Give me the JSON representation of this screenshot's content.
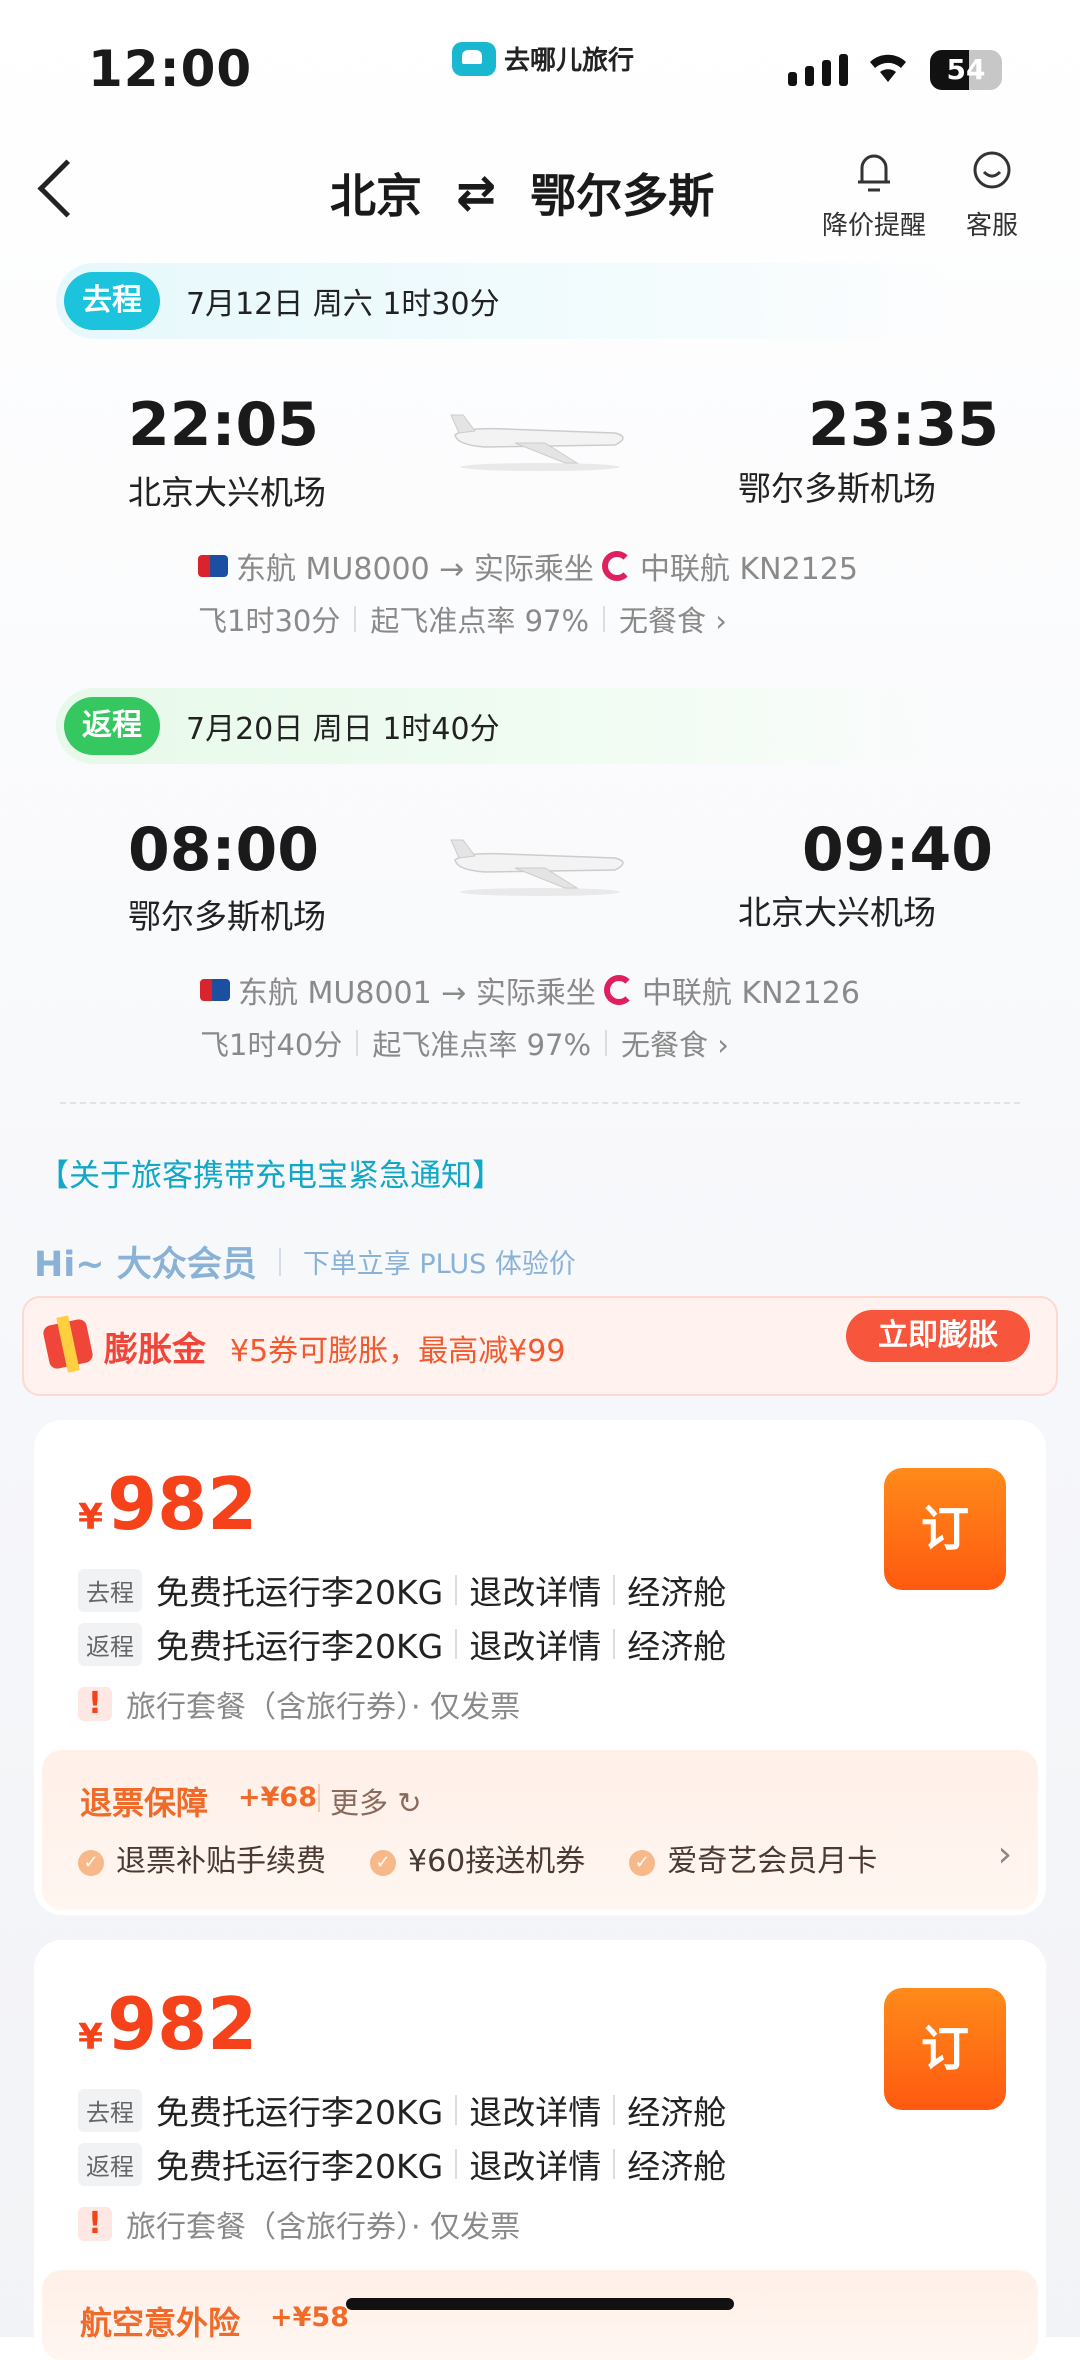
{
  "status": {
    "time": "12:00",
    "battery": "54",
    "brand": "去哪儿旅行"
  },
  "header": {
    "from": "北京",
    "to": "鄂尔多斯",
    "swap_icon": "⇄",
    "back_icon": "chevron-left",
    "alert_label": "降价提醒",
    "service_label": "客服"
  },
  "outbound": {
    "tag": "去程",
    "date_info": "7月12日 周六  1时30分",
    "dep_time": "22:05",
    "dep_airport": "北京大兴机场",
    "arr_time": "23:35",
    "arr_airport": "鄂尔多斯机场",
    "carrier_text": "东航 MU8000 → 实际乘坐",
    "operating_text": "中联航 KN2125",
    "duration": "飞1时30分",
    "ontime": "起飞准点率 97%",
    "meal": "无餐食 ›"
  },
  "return": {
    "tag": "返程",
    "date_info": "7月20日 周日  1时40分",
    "dep_time": "08:00",
    "dep_airport": "鄂尔多斯机场",
    "arr_time": "09:40",
    "arr_airport": "北京大兴机场",
    "carrier_text": "东航 MU8001 → 实际乘坐",
    "operating_text": "中联航 KN2126",
    "duration": "飞1时40分",
    "ontime": "起飞准点率 97%",
    "meal": "无餐食 ›"
  },
  "notice": "【关于旅客携带充电宝紧急通知】",
  "member": {
    "hi": "Hi~ 大众会员",
    "sub": "下单立享 PLUS 体验价"
  },
  "inflate": {
    "title": "膨胀金",
    "desc": "¥5券可膨胀，最高减¥99",
    "button": "立即膨胀"
  },
  "offers": [
    {
      "currency": "¥",
      "price": "982",
      "book": "订",
      "out_label": "去程",
      "ret_label": "返程",
      "baggage": "免费托运行李20KG",
      "refund": "退改详情",
      "cabin": "经济舱",
      "package": "旅行套餐（含旅行券）· 仅发票",
      "protect_title": "退票保障",
      "protect_price": "+¥68",
      "protect_more": "更多 ↻",
      "protect_items": [
        "退票补贴手续费",
        "¥60接送机券",
        "爱奇艺会员月卡"
      ]
    },
    {
      "currency": "¥",
      "price": "982",
      "book": "订",
      "out_label": "去程",
      "ret_label": "返程",
      "baggage": "免费托运行李20KG",
      "refund": "退改详情",
      "cabin": "经济舱",
      "package": "旅行套餐（含旅行券）· 仅发票",
      "protect_title": "航空意外险",
      "protect_price": "+¥58"
    }
  ]
}
